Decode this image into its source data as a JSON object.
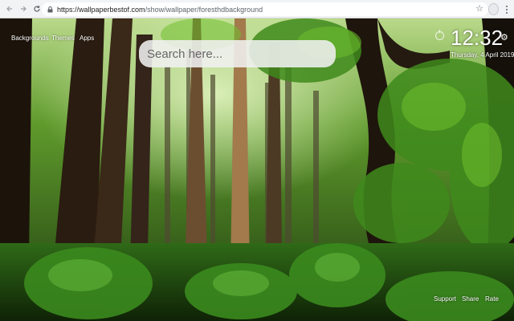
{
  "browser": {
    "back_icon": "arrow-left-icon",
    "forward_icon": "arrow-right-icon",
    "reload_icon": "reload-icon",
    "url_host": "https://wallpaperbestof.com",
    "url_path": "/show/wallpaper/foresthdbackground",
    "bookmark_icon": "star-icon",
    "menu_icon": "menu-dots-icon"
  },
  "nav": {
    "items": [
      {
        "label": "Backgrounds"
      },
      {
        "label": "Themes"
      },
      {
        "label": "Apps"
      }
    ]
  },
  "search": {
    "placeholder": "Search here..."
  },
  "clock": {
    "time": "12:32",
    "date": "Thursday, 4 April 2019"
  },
  "footer": {
    "items": [
      {
        "label": "Support"
      },
      {
        "label": "Share"
      },
      {
        "label": "Rate"
      }
    ]
  },
  "colors": {
    "chrome_bg": "#f1f3f4",
    "forest_dark": "#0c1a08",
    "foliage": "#3f8a1c",
    "text_overlay": "#ffffff"
  }
}
